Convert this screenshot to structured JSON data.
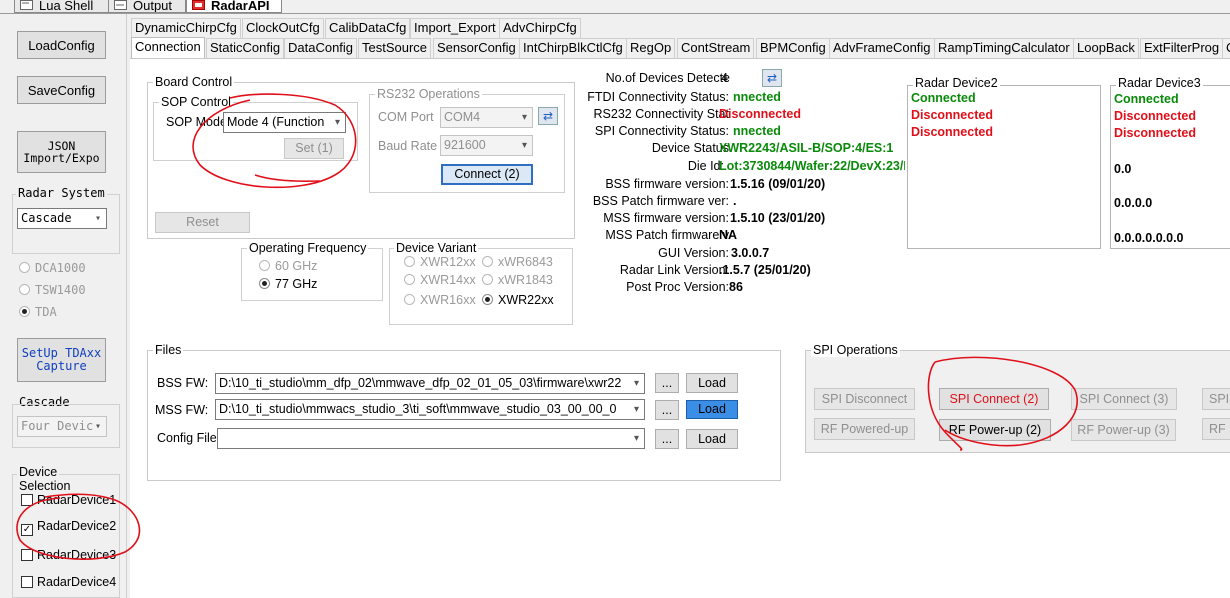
{
  "doc_tabs": [
    {
      "label": "Lua Shell"
    },
    {
      "label": "Output"
    },
    {
      "label": "RadarAPI"
    }
  ],
  "left_panel": {
    "load_config": "LoadConfig",
    "save_config": "SaveConfig",
    "json_import_line1": "JSON",
    "json_import_line2": "Import/Expo",
    "radar_system_label": "Radar System",
    "radar_system_value": "Cascade",
    "capture_options": [
      "DCA1000",
      "TSW1400",
      "TDA"
    ],
    "setup_tda_line1": "SetUp TDAxx",
    "setup_tda_line2": "Capture",
    "cascade_label": "Cascade",
    "cascade_value": "Four Devic",
    "device_selection_line1": "Device",
    "device_selection_line2": "Selection",
    "devices": [
      {
        "label": "RadarDevice1",
        "checked": ""
      },
      {
        "label": "RadarDevice2",
        "checked": "✓"
      },
      {
        "label": "RadarDevice3",
        "checked": ""
      },
      {
        "label": "RadarDevice4",
        "checked": ""
      }
    ]
  },
  "tabs_row1": [
    "DynamicChirpCfg",
    "ClockOutCfg",
    "CalibDataCfg",
    "Import_Export",
    "AdvChirpCfg"
  ],
  "tabs_row2": [
    "Connection",
    "StaticConfig",
    "DataConfig",
    "TestSource",
    "SensorConfig",
    "IntChirpBlkCtlCfg",
    "RegOp",
    "ContStream",
    "BPMConfig",
    "AdvFrameConfig",
    "RampTimingCalculator",
    "LoopBack",
    "ExtFilterProg",
    "C"
  ],
  "board_control": {
    "title": "Board Control",
    "sop_control_title": "SOP Control",
    "sop_mode_label": "SOP Mode",
    "sop_mode_value": "Mode 4 (Function",
    "set_button": "Set (1)",
    "reset_button": "Reset"
  },
  "rs232": {
    "title": "RS232 Operations",
    "com_port_label": "COM Port",
    "com_port_value": "COM4",
    "baud_rate_label": "Baud Rate",
    "baud_rate_value": "921600",
    "connect_button": "Connect (2)"
  },
  "operating_frequency": {
    "title": "Operating Frequency",
    "options": [
      "60 GHz",
      "77 GHz"
    ]
  },
  "device_variant": {
    "title": "Device Variant",
    "options": [
      "XWR12xx",
      "xWR6843",
      "XWR14xx",
      "xWR1843",
      "XWR16xx",
      "XWR22xx"
    ]
  },
  "status": {
    "num_devices_label": "No.of Devices Detecte",
    "num_devices_value": "4",
    "ftdi_label": "FTDI Connectivity Status:",
    "ftdi_value": "nnected",
    "rs232_label": "RS232 Connectivity Stat",
    "rs232_value": "Disconnected",
    "spi_label": "SPI Connectivity Status:",
    "spi_value": "nnected",
    "device_status_label": "Device Status",
    "device_status_value": "XWR2243/ASIL-B/SOP:4/ES:1",
    "die_id_label": "Die Id:",
    "die_id_value": "Lot:3730844/Wafer:22/DevX:23/D",
    "bss_fw_label": "BSS firmware version:",
    "bss_fw_value": "1.5.16 (09/01/20)",
    "bss_patch_label": "BSS Patch firmware ver:",
    "bss_patch_value": ".",
    "mss_fw_label": "MSS firmware version:",
    "mss_fw_value": "1.5.10 (23/01/20)",
    "mss_patch_label": "MSS Patch firmware v",
    "mss_patch_value": "NA",
    "gui_label": "GUI Version:",
    "gui_value": "3.0.0.7",
    "radar_link_label": "Radar Link Version:",
    "radar_link_value": ".1.5.7 (25/01/20)",
    "post_proc_label": "Post Proc Version:",
    "post_proc_value": "86"
  },
  "radar_device2": {
    "title": "Radar Device2",
    "lines": [
      "Connected",
      "Disconnected",
      "Disconnected"
    ]
  },
  "radar_device3": {
    "title": "Radar Device3",
    "lines": [
      "Connected",
      "Disconnected",
      "Disconnected"
    ],
    "value1": "0.0",
    "value2": "0.0.0.0",
    "value3": "0.0.0.0.0.0.0"
  },
  "files": {
    "title": "Files",
    "bss_label": "BSS FW:",
    "bss_path": "D:\\10_ti_studio\\mm_dfp_02\\mmwave_dfp_02_01_05_03\\firmware\\xwr22",
    "mss_label": "MSS FW:",
    "mss_path": "D:\\10_ti_studio\\mmwacs_studio_3\\ti_soft\\mmwave_studio_03_00_00_0",
    "config_label": "Config File",
    "config_path": "",
    "browse": "...",
    "load": "Load"
  },
  "spi_ops": {
    "title": "SPI Operations",
    "spi_disconnect": "SPI Disconnect",
    "spi_connect2": "SPI Connect (2)",
    "spi_connect3": "SPI Connect (3)",
    "spi_partial": "SPI",
    "rf_powered_up": "RF Powered-up",
    "rf_power_up2": "RF Power-up (2)",
    "rf_power_up3": "RF Power-up (3)",
    "rf_partial": "RF"
  },
  "colors": {
    "connected": "#0a8a0a",
    "disconnected": "#e0101a",
    "annotation": "#e0101a",
    "active_button": "#3a8ee6"
  }
}
